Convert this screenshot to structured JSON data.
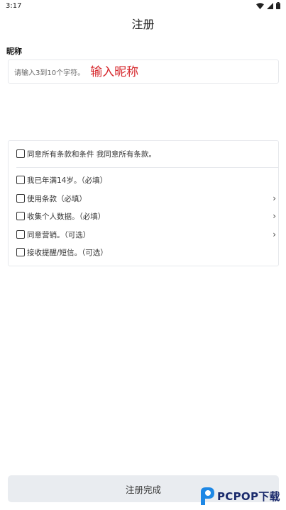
{
  "status_bar": {
    "time": "3:17",
    "icons": [
      "wifi-icon",
      "signal-icon",
      "battery-icon"
    ]
  },
  "header": {
    "title": "注册"
  },
  "nickname": {
    "label": "昵称",
    "placeholder": "请输入3到10个字符。",
    "annotation": "输入昵称"
  },
  "agreements": {
    "all": "同意所有条款和条件 我同意所有条款。",
    "items": [
      {
        "label": "我已年满14岁。（必填）",
        "has_chevron": false
      },
      {
        "label": "使用条款（必填）",
        "has_chevron": true
      },
      {
        "label": "收集个人数据。（必填）",
        "has_chevron": true
      },
      {
        "label": "同意营销。（可选）",
        "has_chevron": true
      },
      {
        "label": "接收提醒/短信。（可选）",
        "has_chevron": false
      }
    ],
    "chevron": "›"
  },
  "footer": {
    "submit_label": "注册完成"
  },
  "watermark": {
    "text": "PCPOP下载"
  },
  "colors": {
    "annotation": "#d6262b",
    "button_bg": "#e9ecf0",
    "border": "#e6e8ec"
  }
}
